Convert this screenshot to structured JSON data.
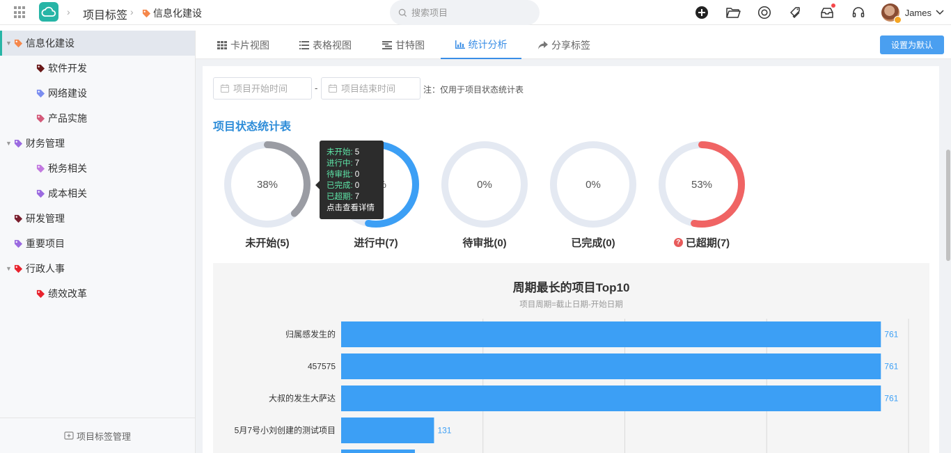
{
  "header": {
    "breadcrumb_title": "项目标签",
    "current_tag": "信息化建设",
    "search_placeholder": "搜索项目",
    "user_name": "James"
  },
  "sidebar": {
    "items": [
      {
        "label": "信息化建设",
        "level": 0,
        "expanded": true,
        "active": true,
        "color": "#f5874b"
      },
      {
        "label": "软件开发",
        "level": 1,
        "color": "#6b1a1a"
      },
      {
        "label": "网络建设",
        "level": 1,
        "color": "#7b8ef0"
      },
      {
        "label": "产品实施",
        "level": 1,
        "color": "#d45a7a"
      },
      {
        "label": "财务管理",
        "level": 0,
        "expanded": true,
        "color": "#9b6be0"
      },
      {
        "label": "税务相关",
        "level": 1,
        "color": "#c279e0"
      },
      {
        "label": "成本相关",
        "level": 1,
        "color": "#9b6be0"
      },
      {
        "label": "研发管理",
        "level": 0,
        "color": "#7a1f2e"
      },
      {
        "label": "重要项目",
        "level": 0,
        "color": "#9b6be0"
      },
      {
        "label": "行政人事",
        "level": 0,
        "expanded": true,
        "color": "#e8232e"
      },
      {
        "label": "绩效改革",
        "level": 1,
        "color": "#e8232e"
      }
    ],
    "footer_label": "项目标签管理"
  },
  "tabs": [
    {
      "label": "卡片视图",
      "icon": "grid-icon"
    },
    {
      "label": "表格视图",
      "icon": "list-icon"
    },
    {
      "label": "甘特图",
      "icon": "gantt-icon"
    },
    {
      "label": "统计分析",
      "icon": "bar-chart-icon",
      "active": true
    },
    {
      "label": "分享标签",
      "icon": "share-icon"
    }
  ],
  "default_button": "设置为默认",
  "filters": {
    "start_placeholder": "项目开始时间",
    "end_placeholder": "项目结束时间",
    "dash": "-",
    "note": "注：仅用于项目状态统计表"
  },
  "status_section": {
    "title": "项目状态统计表",
    "donuts": [
      {
        "label": "未开始(5)",
        "percent": 38,
        "pct_text": "38%",
        "color": "#9a9ca3"
      },
      {
        "label": "进行中(7)",
        "percent": 53,
        "pct_text": "53%",
        "color": "#3c9ff5"
      },
      {
        "label": "待审批(0)",
        "percent": 0,
        "pct_text": "0%",
        "color": "#3c9ff5"
      },
      {
        "label": "已完成(0)",
        "percent": 0,
        "pct_text": "0%",
        "color": "#3c9ff5"
      },
      {
        "label": "已超期(7)",
        "percent": 53,
        "pct_text": "53%",
        "color": "#f06464",
        "help": true
      }
    ],
    "tooltip": {
      "rows": [
        {
          "k": "未开始:",
          "v": "5"
        },
        {
          "k": "进行中:",
          "v": "7"
        },
        {
          "k": "待审批:",
          "v": "0"
        },
        {
          "k": "已完成:",
          "v": "0"
        },
        {
          "k": "已超期:",
          "v": "7"
        }
      ],
      "footer": "点击查看详情"
    }
  },
  "colors": {
    "accent": "#3a8ee6",
    "bar": "#3c9ff5",
    "track": "#e4e9f2"
  },
  "chart_data": {
    "type": "bar",
    "orientation": "horizontal",
    "title": "周期最长的项目Top10",
    "subtitle": "项目周期=截止日期-开始日期",
    "categories": [
      "归属感发生的",
      "457575",
      "大叔的发生大萨达",
      "5月7号小刘创建的测试项目"
    ],
    "values": [
      761,
      761,
      761,
      131
    ],
    "partial_extra_value": 104,
    "xlim": [
      0,
      800
    ],
    "grid": true
  }
}
